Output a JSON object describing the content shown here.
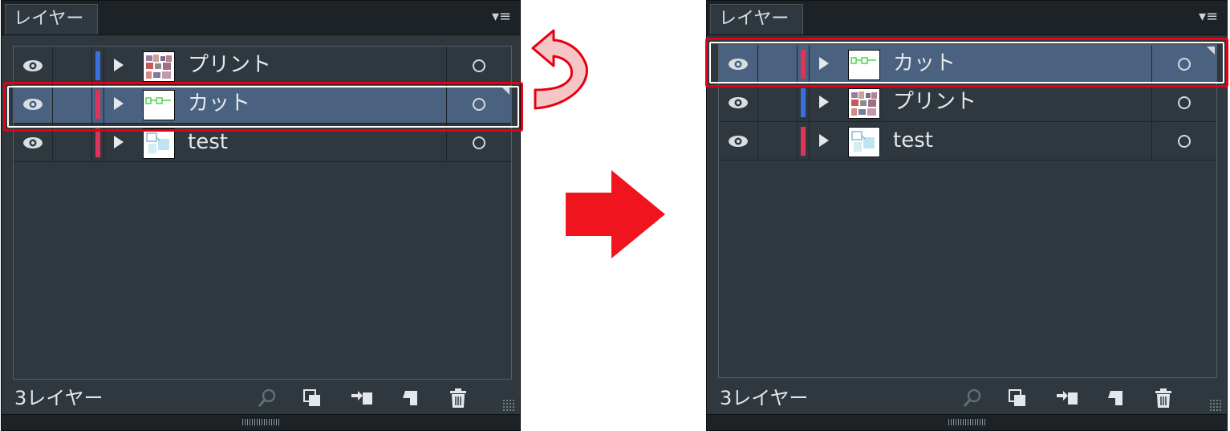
{
  "before_panel": {
    "tab_title": "レイヤー",
    "menu_icon": "panel-menu-icon",
    "layer_count": "3レイヤー",
    "layers": [
      {
        "name": "プリント",
        "color": "#3a6fe0",
        "selected": false,
        "thumb": "print"
      },
      {
        "name": "カット",
        "color": "#e0335a",
        "selected": true,
        "thumb": "cut"
      },
      {
        "name": "test",
        "color": "#e0335a",
        "selected": false,
        "thumb": "test"
      }
    ]
  },
  "after_panel": {
    "tab_title": "レイヤー",
    "menu_icon": "panel-menu-icon",
    "layer_count": "3レイヤー",
    "layers": [
      {
        "name": "カット",
        "color": "#e0335a",
        "selected": true,
        "thumb": "cut"
      },
      {
        "name": "プリント",
        "color": "#3a6fe0",
        "selected": false,
        "thumb": "print"
      },
      {
        "name": "test",
        "color": "#e0335a",
        "selected": false,
        "thumb": "test"
      }
    ]
  },
  "footer_icons": [
    "search-icon",
    "clipping-mask-icon",
    "new-sublayer-icon",
    "new-layer-icon",
    "trash-icon"
  ],
  "annotation": {
    "highlight_color": "#e60012",
    "curved_arrow": "move-up-arrow",
    "transition_arrow": "right-arrow"
  }
}
